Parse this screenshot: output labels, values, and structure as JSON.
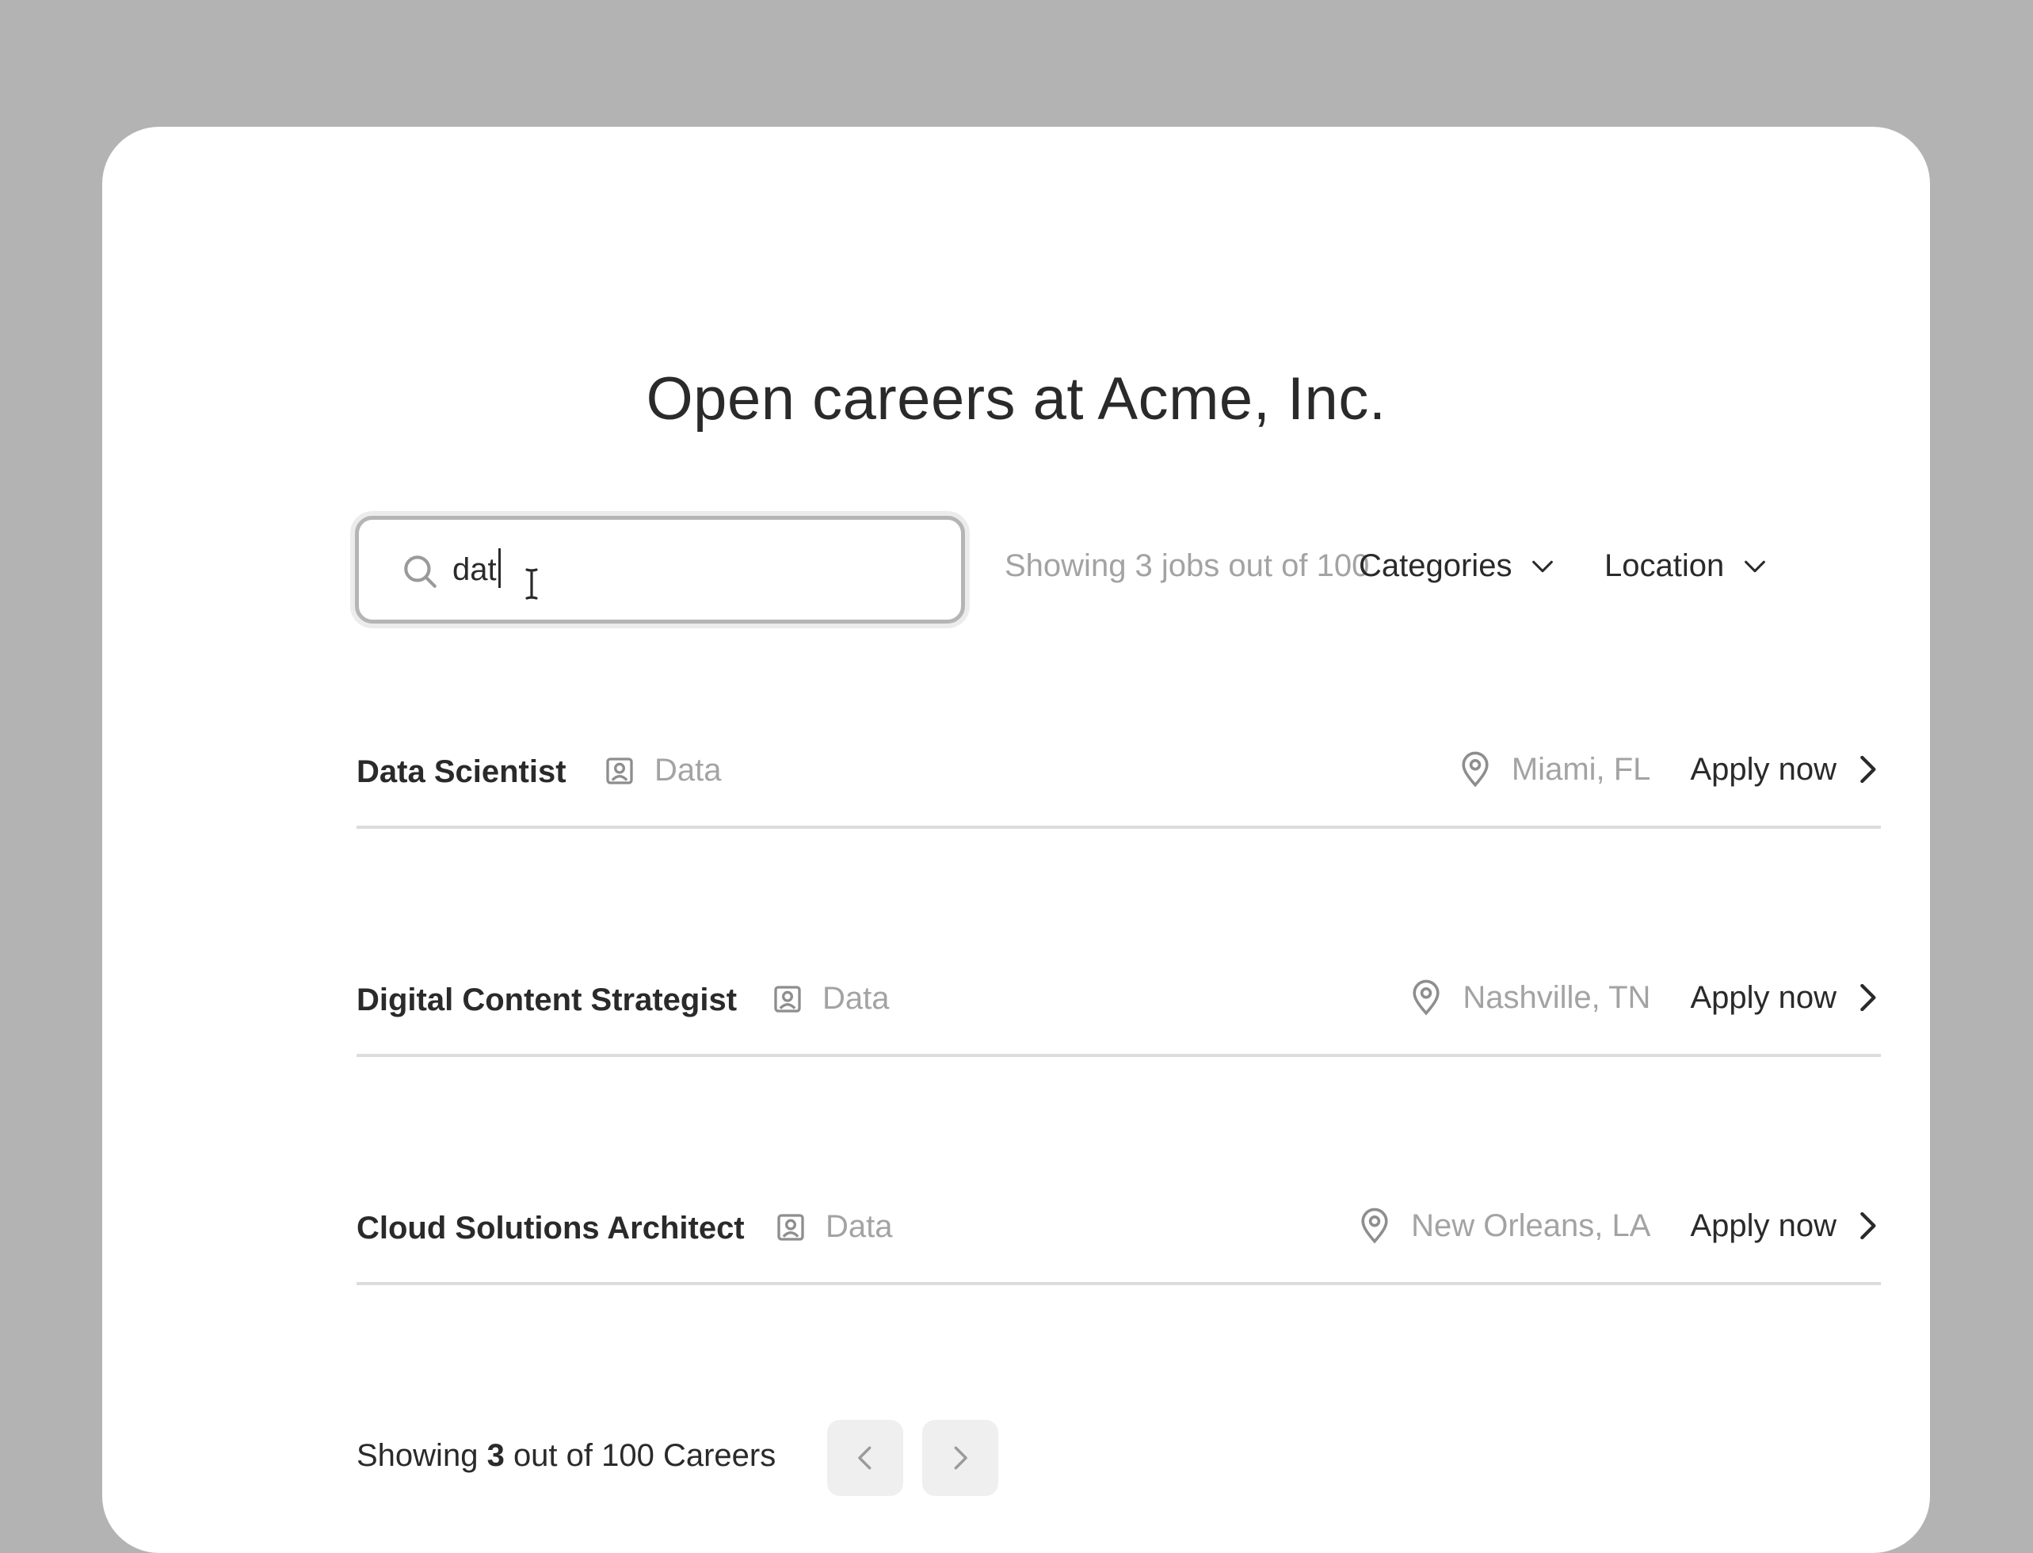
{
  "page": {
    "title": "Open careers at Acme, Inc."
  },
  "search": {
    "value": "dat",
    "placeholder": "",
    "icon": "search-icon"
  },
  "results_summary": "Showing 3 jobs out of 100",
  "filters": [
    {
      "label": "Categories",
      "icon": "chevron-down-icon"
    },
    {
      "label": "Location",
      "icon": "chevron-down-icon"
    }
  ],
  "jobs": [
    {
      "title": "Data Scientist",
      "category": "Data",
      "location": "Miami, FL",
      "action": "Apply now"
    },
    {
      "title": "Digital Content Strategist",
      "category": "Data",
      "location": "Nashville, TN",
      "action": "Apply now"
    },
    {
      "title": "Cloud Solutions Architect",
      "category": "Data",
      "location": "New Orleans, LA",
      "action": "Apply now"
    }
  ],
  "footer": {
    "prefix": "Showing",
    "count": "3",
    "suffix": "out of 100 Careers"
  },
  "pagination": {
    "prev_icon": "chevron-left-icon",
    "next_icon": "chevron-right-icon"
  },
  "colors": {
    "backdrop": "#b3b3b3",
    "card": "#ffffff",
    "text": "#2a2a2a",
    "muted": "#a3a3a3",
    "divider": "#dcdcdc",
    "pager_bg": "#efefef"
  }
}
